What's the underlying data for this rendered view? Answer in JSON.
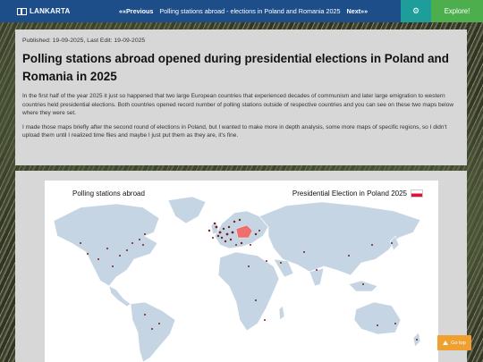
{
  "topbar": {
    "logo_text": "LANKARTA",
    "prev_label": "««Previous",
    "article_link": "Polling stations abroad - elections in Poland and Romania 2025",
    "next_label": "Next»»",
    "settings_icon": "gear-icon",
    "explore_label": "Explore!"
  },
  "article": {
    "meta": "Published: 19-09-2025, Last Edit: 19-09-2025",
    "title": "Polling stations abroad opened during presidential elections in Poland and Romania in 2025",
    "paragraph1": "In the first half of the year 2025 it just so happened that two large European countries that experienced decades of communism and later large emigration to western countries held presidential elections. Both countries opened record number of polling stations outside of respective countries and you can see on these two maps below where they were set.",
    "paragraph2": "I made those maps briefly after the second round of elections in Poland, but I wanted to make more in depth analysis, some more maps of specific regions, so I didn't upload them until I realized time flies and maybe I just put them as they are, it's fine."
  },
  "map": {
    "title_left": "Polling stations abroad",
    "title_right": "Presidential Election in Poland 2025",
    "land_color": "#c6d5e4",
    "highlight_color": "#ef6f6f",
    "dot_color": "#7a1f1f"
  },
  "go_top": {
    "label": "Go top"
  }
}
